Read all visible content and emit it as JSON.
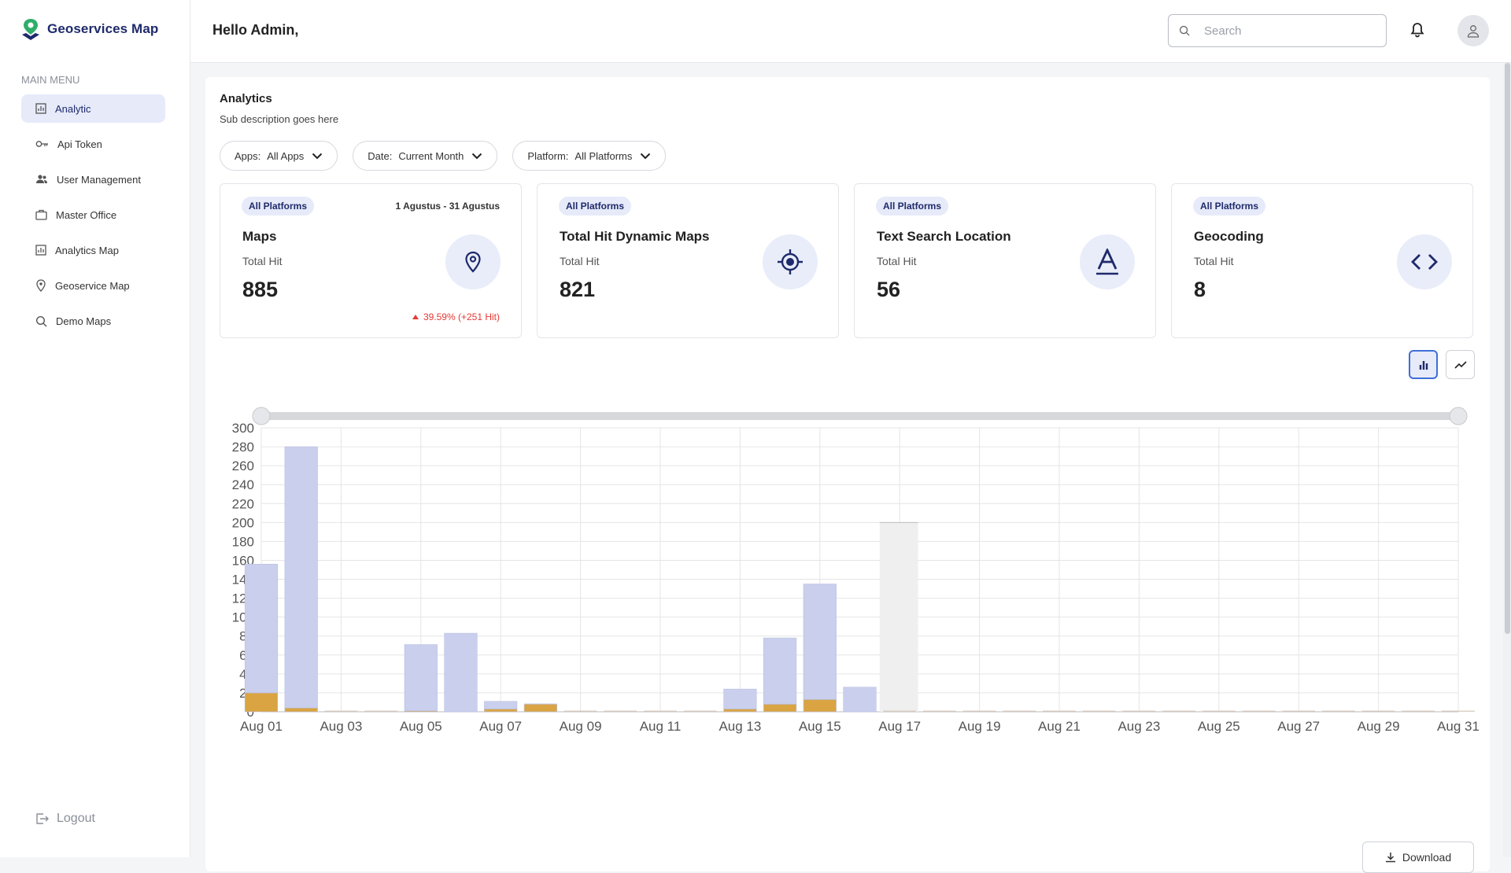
{
  "app": {
    "name": "Geoservices Map"
  },
  "sidebar": {
    "heading": "MAIN MENU",
    "items": [
      {
        "label": "Analytic",
        "icon": "chart-icon"
      },
      {
        "label": "Api Token",
        "icon": "key-icon"
      },
      {
        "label": "User Management",
        "icon": "users-icon"
      },
      {
        "label": "Master Office",
        "icon": "briefcase-icon"
      },
      {
        "label": "Analytics Map",
        "icon": "chart-icon"
      },
      {
        "label": "Geoservice Map",
        "icon": "location-pin-icon"
      },
      {
        "label": "Demo Maps",
        "icon": "search-icon"
      }
    ],
    "logout": "Logout"
  },
  "header": {
    "greeting": "Hello Admin,",
    "search_placeholder": "Search"
  },
  "analytics": {
    "title": "Analytics",
    "subtitle": "Sub description goes here",
    "filters": [
      {
        "label": "Apps:",
        "value": "All Apps"
      },
      {
        "label": "Date:",
        "value": "Current Month"
      },
      {
        "label": "Platform:",
        "value": "All Platforms"
      }
    ],
    "stats": [
      {
        "badge": "All Platforms",
        "date_range": "1 Agustus - 31 Agustus",
        "title": "Maps",
        "label": "Total Hit",
        "value": "885",
        "change": "39.59% (+251 Hit)",
        "icon": "location-pin-icon"
      },
      {
        "badge": "All Platforms",
        "title": "Total Hit Dynamic Maps",
        "label": "Total Hit",
        "value": "821",
        "icon": "crosshair-icon"
      },
      {
        "badge": "All Platforms",
        "title": "Text Search Location",
        "label": "Total Hit",
        "value": "56",
        "icon": "text-icon"
      },
      {
        "badge": "All Platforms",
        "title": "Geocoding",
        "label": "Total Hit",
        "value": "8",
        "icon": "code-icon"
      }
    ],
    "download_label": "Download"
  },
  "colors": {
    "primary": "#1e2a6b",
    "accent": "#3f6fd8",
    "series_lavender": "#c9cfec",
    "series_gold": "#d9a441",
    "change_red": "#e53935"
  },
  "chart_data": {
    "type": "bar",
    "stacked": true,
    "x": [
      "Aug 01",
      "Aug 02",
      "Aug 03",
      "Aug 04",
      "Aug 05",
      "Aug 06",
      "Aug 07",
      "Aug 08",
      "Aug 09",
      "Aug 10",
      "Aug 11",
      "Aug 12",
      "Aug 13",
      "Aug 14",
      "Aug 15",
      "Aug 16",
      "Aug 17",
      "Aug 18",
      "Aug 19",
      "Aug 20",
      "Aug 21",
      "Aug 22",
      "Aug 23",
      "Aug 24",
      "Aug 25",
      "Aug 26",
      "Aug 27",
      "Aug 28",
      "Aug 29",
      "Aug 30",
      "Aug 31"
    ],
    "x_tick_labels": [
      "Aug 01",
      "Aug 03",
      "Aug 05",
      "Aug 07",
      "Aug 09",
      "Aug 11",
      "Aug 13",
      "Aug 15",
      "Aug 17",
      "Aug 19",
      "Aug 21",
      "Aug 23",
      "Aug 25",
      "Aug 27",
      "Aug 29",
      "Aug 31"
    ],
    "series": [
      {
        "color": "#d9a441",
        "values": [
          20,
          4,
          0,
          0,
          1,
          0,
          3,
          8,
          0,
          0,
          0,
          0,
          3,
          8,
          13,
          0,
          0,
          0,
          0,
          0,
          0,
          0,
          0,
          0,
          0,
          0,
          0,
          0,
          0,
          0,
          0
        ]
      },
      {
        "color": "#c9cfec",
        "values": [
          136,
          276,
          0,
          0,
          70,
          83,
          8,
          0,
          0,
          0,
          0,
          0,
          21,
          70,
          122,
          26,
          0,
          0,
          0,
          0,
          0,
          0,
          0,
          0,
          0,
          0,
          0,
          0,
          0,
          0,
          0
        ]
      }
    ],
    "highlight": {
      "category": "Aug 17",
      "value": 200
    },
    "ylim": [
      0,
      300
    ],
    "y_ticks": [
      0,
      20,
      40,
      60,
      80,
      100,
      120,
      140,
      160,
      180,
      200,
      220,
      240,
      260,
      280,
      300
    ],
    "grid": true
  }
}
